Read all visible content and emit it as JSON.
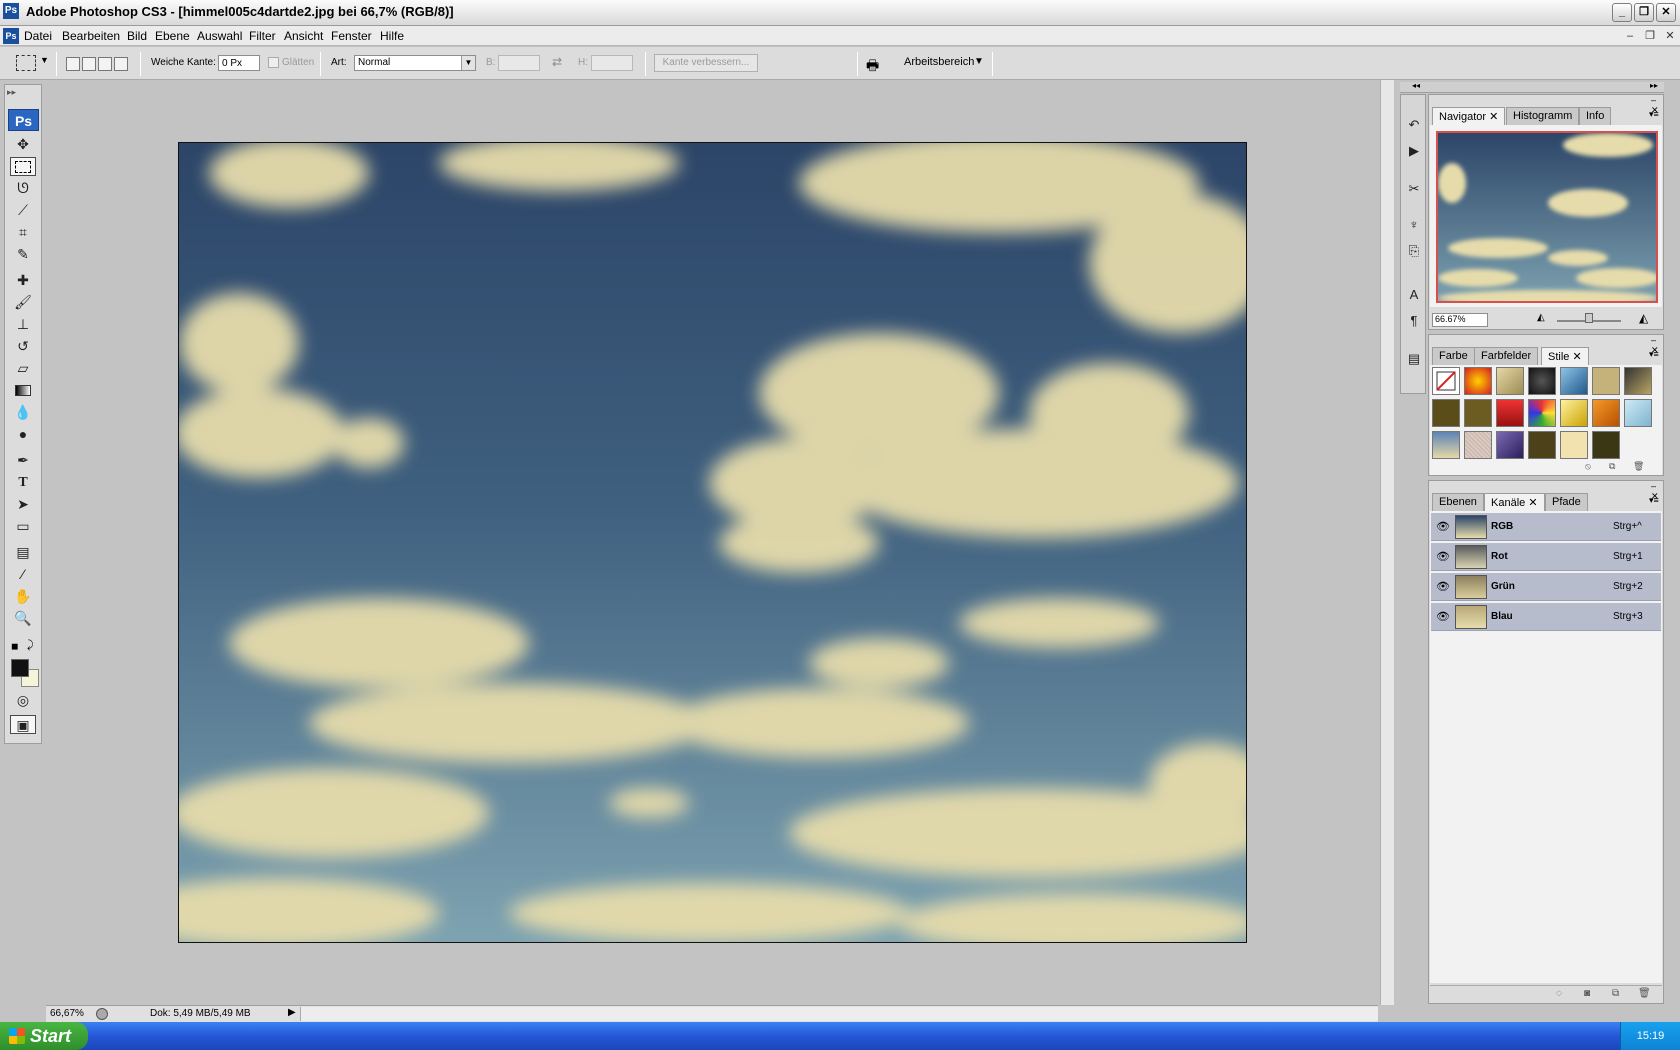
{
  "window": {
    "title": "Adobe Photoshop CS3 - [himmel005c4dartde2.jpg bei 66,7% (RGB/8)]",
    "app_icon": "Ps"
  },
  "menu": [
    "Datei",
    "Bearbeiten",
    "Bild",
    "Ebene",
    "Auswahl",
    "Filter",
    "Ansicht",
    "Fenster",
    "Hilfe"
  ],
  "options": {
    "feather_label": "Weiche Kante:",
    "feather_value": "0 Px",
    "antialias_label": "Glätten",
    "style_label": "Art:",
    "style_value": "Normal",
    "width_label": "B:",
    "height_label": "H:",
    "refine_edge_label": "Kante verbessern...",
    "workspace_label": "Arbeitsbereich"
  },
  "toolbox": {
    "badge": "Ps",
    "tools": [
      "move-tool",
      "marquee-tool",
      "lasso-tool",
      "magic-wand-tool",
      "crop-tool",
      "slice-tool",
      "healing-brush-tool",
      "brush-tool",
      "clone-stamp-tool",
      "history-brush-tool",
      "eraser-tool",
      "gradient-tool",
      "blur-tool",
      "dodge-tool",
      "pen-tool",
      "type-tool",
      "path-selection-tool",
      "shape-tool",
      "notes-tool",
      "eyedropper-tool",
      "hand-tool",
      "zoom-tool"
    ]
  },
  "status": {
    "zoom": "66,67%",
    "doc_info": "Dok: 5,49 MB/5,49 MB"
  },
  "navigator": {
    "tabs": [
      "Navigator",
      "Histogramm",
      "Info"
    ],
    "zoom": "66.67%"
  },
  "color_panel": {
    "tabs": [
      "Farbe",
      "Farbfelder",
      "Stile"
    ]
  },
  "channels_panel": {
    "tabs": [
      "Ebenen",
      "Kanäle",
      "Pfade"
    ],
    "channels": [
      {
        "name": "RGB",
        "shortcut": "Strg+^"
      },
      {
        "name": "Rot",
        "shortcut": "Strg+1"
      },
      {
        "name": "Grün",
        "shortcut": "Strg+2"
      },
      {
        "name": "Blau",
        "shortcut": "Strg+3"
      }
    ]
  },
  "taskbar": {
    "start_label": "Start",
    "clock": "15:19"
  },
  "colors": {
    "sky_top": "#2f4a6e",
    "sky_bottom": "#6f9ab0",
    "cloud": "#e8dfb0",
    "photoshop_blue": "#2b66c1",
    "xp_taskbar": "#2457d7",
    "xp_start": "#3aa23a"
  }
}
